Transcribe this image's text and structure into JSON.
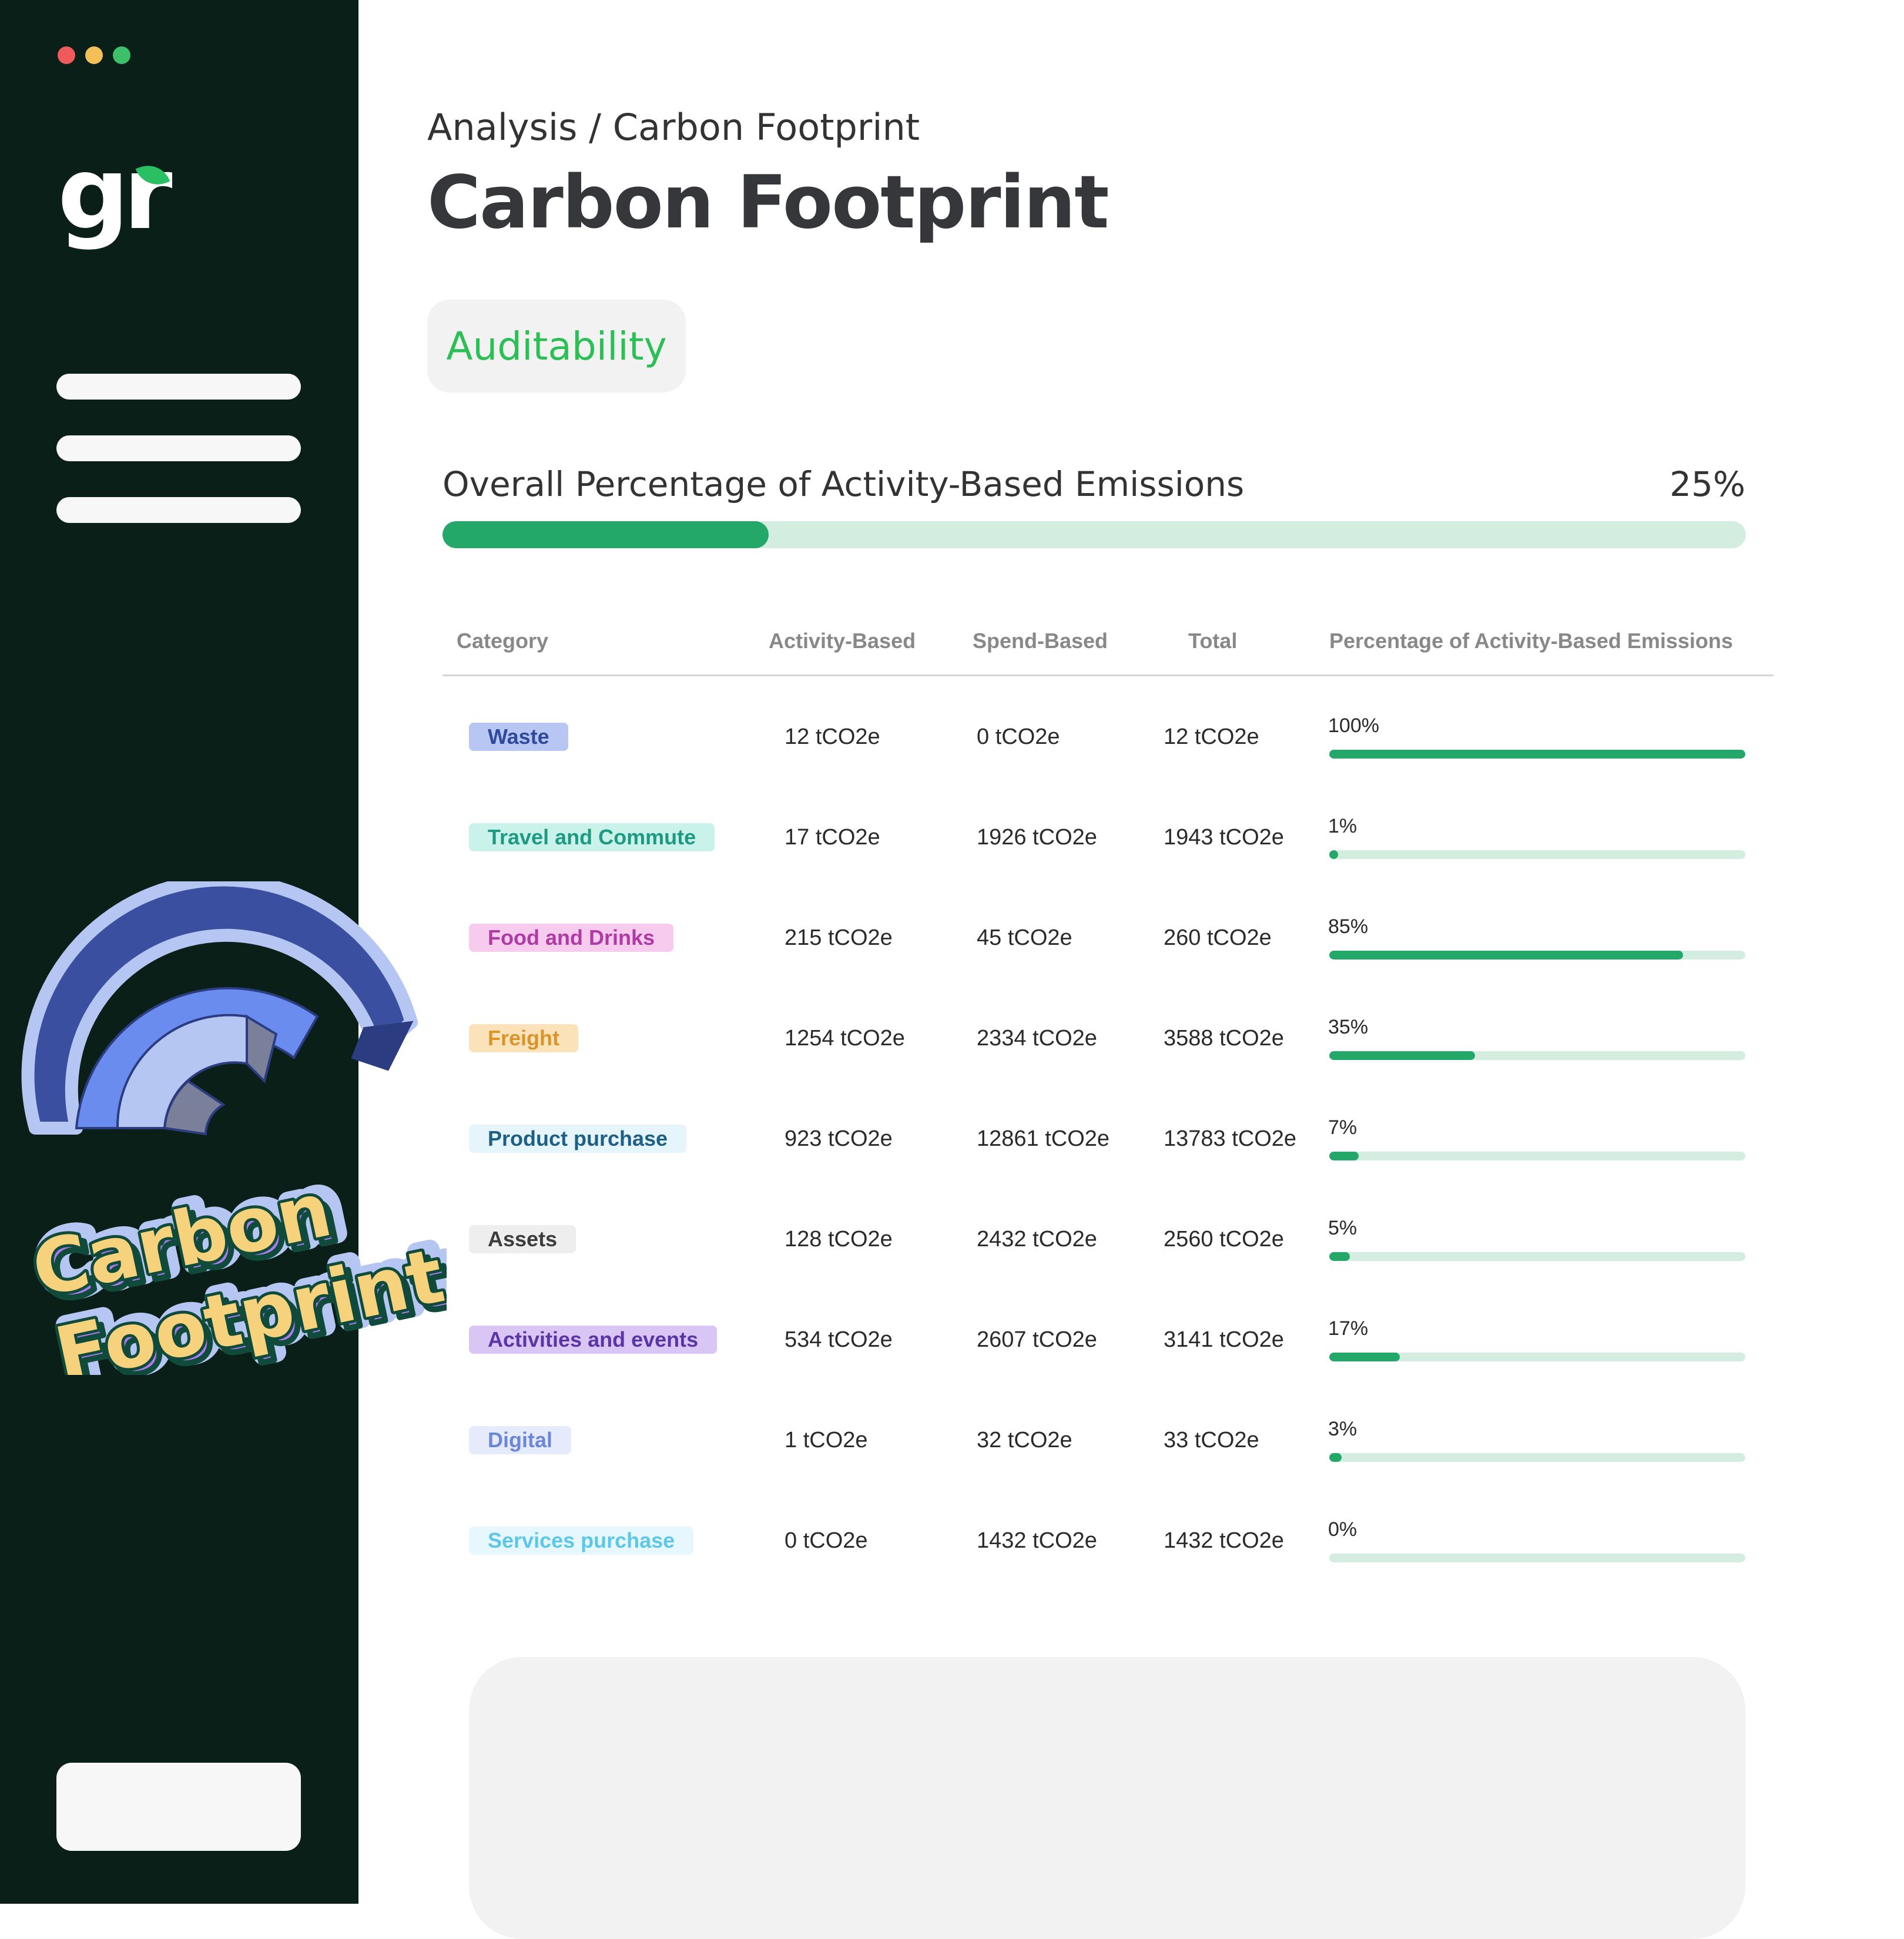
{
  "window": {
    "controls": [
      "close",
      "minimize",
      "maximize"
    ]
  },
  "sidebar": {
    "logo_text": "gr"
  },
  "header": {
    "breadcrumb": "Analysis / Carbon Footprint",
    "title": "Carbon Footprint"
  },
  "tabs": [
    {
      "label": "Auditability",
      "active": true
    }
  ],
  "overall": {
    "label": "Overall Percentage of Activity-Based Emissions",
    "value_text": "25%",
    "percent": 25
  },
  "table": {
    "columns": [
      "Category",
      "Activity-Based",
      "Spend-Based",
      "Total",
      "Percentage of Activity-Based Emissions"
    ],
    "rows": [
      {
        "category": "Waste",
        "activity": "12 tCO2e",
        "spend": "0 tCO2e",
        "total": "12 tCO2e",
        "percent_text": "100%",
        "percent": 100,
        "pill_bg": "#b7c6f2",
        "pill_fg": "#2f4a9c"
      },
      {
        "category": "Travel and Commute",
        "activity": "17 tCO2e",
        "spend": "1926 tCO2e",
        "total": "1943 tCO2e",
        "percent_text": "1%",
        "percent": 1,
        "pill_bg": "#c9f2ea",
        "pill_fg": "#1f9a82"
      },
      {
        "category": "Food and Drinks",
        "activity": "215 tCO2e",
        "spend": "45 tCO2e",
        "total": "260 tCO2e",
        "percent_text": "85%",
        "percent": 85,
        "pill_bg": "#f7cbee",
        "pill_fg": "#b03aa3"
      },
      {
        "category": "Freight",
        "activity": "1254 tCO2e",
        "spend": "2334 tCO2e",
        "total": "3588 tCO2e",
        "percent_text": "35%",
        "percent": 35,
        "pill_bg": "#fbe2b8",
        "pill_fg": "#d99529"
      },
      {
        "category": "Product purchase",
        "activity": "923 tCO2e",
        "spend": "12861 tCO2e",
        "total": "13783 tCO2e",
        "percent_text": "7%",
        "percent": 7,
        "pill_bg": "#e6f4fb",
        "pill_fg": "#1d5f86"
      },
      {
        "category": "Assets",
        "activity": "128 tCO2e",
        "spend": "2432 tCO2e",
        "total": "2560 tCO2e",
        "percent_text": "5%",
        "percent": 5,
        "pill_bg": "#eeeeee",
        "pill_fg": "#3d3d3d"
      },
      {
        "category": "Activities and events",
        "activity": "534 tCO2e",
        "spend": "2607 tCO2e",
        "total": "3141 tCO2e",
        "percent_text": "17%",
        "percent": 17,
        "pill_bg": "#d9c6f5",
        "pill_fg": "#5b35a6"
      },
      {
        "category": "Digital",
        "activity": "1 tCO2e",
        "spend": "32 tCO2e",
        "total": "33 tCO2e",
        "percent_text": "3%",
        "percent": 3,
        "pill_bg": "#e6ebfb",
        "pill_fg": "#6c86d8"
      },
      {
        "category": "Services purchase",
        "activity": "0 tCO2e",
        "spend": "1432 tCO2e",
        "total": "1432  tCO2e",
        "percent_text": "0%",
        "percent": 0,
        "pill_bg": "#e6f7fd",
        "pill_fg": "#5cc7ea"
      }
    ]
  },
  "sticker": {
    "line1": "Carbon",
    "line2": "Footprint"
  },
  "colors": {
    "sidebar_bg": "#0a1f17",
    "accent_green": "#23a86a",
    "track_green": "#d4ede1",
    "tab_text": "#2bbf55",
    "sticker_text": "#f7d27c",
    "sticker_stroke": "#0f4a3a"
  }
}
